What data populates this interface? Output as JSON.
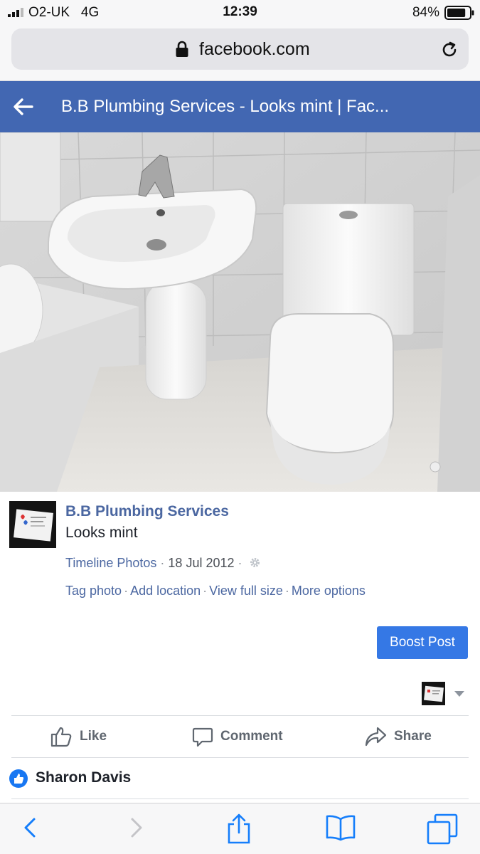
{
  "status_bar": {
    "carrier": "O2-UK",
    "network": "4G",
    "time": "12:39",
    "battery_percent": "84%",
    "battery_level": 0.84
  },
  "browser": {
    "url": "facebook.com",
    "lock_icon": "lock-icon",
    "reload_icon": "reload-icon"
  },
  "header": {
    "title": "B.B Plumbing Services - Looks mint | Fac...",
    "back_icon": "back-arrow-icon",
    "color": "#4267b2"
  },
  "post": {
    "page_name": "B.B Plumbing Services",
    "caption": "Looks mint",
    "album": "Timeline Photos",
    "separator": "·",
    "date": "18 Jul 2012",
    "options": [
      "Tag photo",
      "Add location",
      "View full size",
      "More options"
    ],
    "boost_label": "Boost Post",
    "boost_color": "#3578e5"
  },
  "reactions": {
    "like_label": "Like",
    "comment_label": "Comment",
    "share_label": "Share"
  },
  "likes": {
    "name": "Sharon Davis"
  },
  "toolbar": {
    "icons": [
      "back-icon",
      "forward-icon",
      "share-icon",
      "bookmarks-icon",
      "tabs-icon"
    ],
    "accent": "#157efb"
  }
}
